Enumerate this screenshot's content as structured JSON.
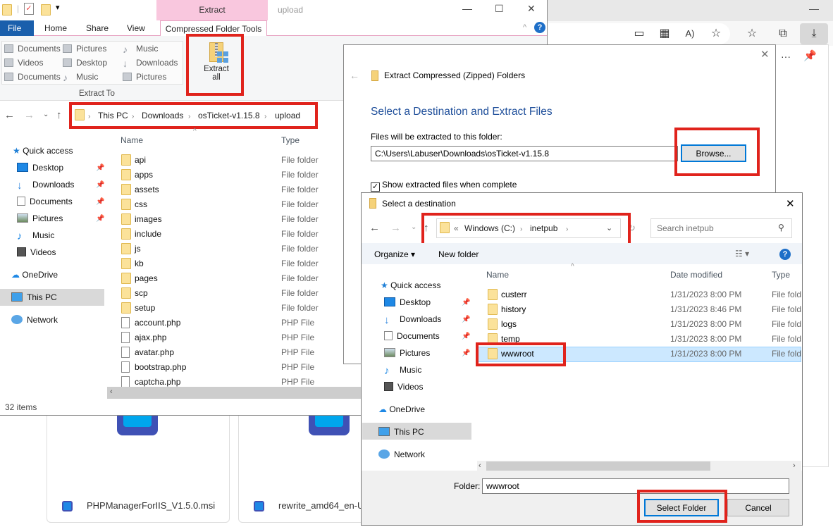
{
  "browser": {
    "toolbar_icons": [
      "app-available-icon",
      "tab-grid-icon",
      "read-aloud-icon",
      "add-favorite-icon",
      "favorites-icon",
      "collections-icon",
      "downloads-icon"
    ],
    "panel_icons": [
      "more-icon",
      "pin-icon"
    ],
    "downloads": [
      {
        "name": "PHPManagerForIIS_V1.5.0.msi"
      },
      {
        "name": "rewrite_amd64_en-U"
      }
    ]
  },
  "explorer": {
    "context_tab": "Extract",
    "window_title": "upload",
    "tabs": [
      "File",
      "Home",
      "Share",
      "View",
      "Compressed Folder Tools"
    ],
    "extract_to": {
      "items": [
        [
          "Documents",
          "Pictures",
          "Music"
        ],
        [
          "Videos",
          "Desktop",
          "Downloads"
        ],
        [
          "Documents",
          "Music",
          "Pictures"
        ]
      ],
      "group_label": "Extract To"
    },
    "extract_all_label_1": "Extract",
    "extract_all_label_2": "all",
    "breadcrumb": [
      "This PC",
      "Downloads",
      "osTicket-v1.15.8",
      "upload"
    ],
    "sidebar": {
      "quick_access": "Quick access",
      "items": [
        "Desktop",
        "Downloads",
        "Documents",
        "Pictures",
        "Music",
        "Videos"
      ],
      "onedrive": "OneDrive",
      "this_pc": "This PC",
      "network": "Network"
    },
    "columns": {
      "name": "Name",
      "type": "Type"
    },
    "files": [
      {
        "name": "api",
        "type": "File folder",
        "kind": "folder"
      },
      {
        "name": "apps",
        "type": "File folder",
        "kind": "folder"
      },
      {
        "name": "assets",
        "type": "File folder",
        "kind": "folder"
      },
      {
        "name": "css",
        "type": "File folder",
        "kind": "folder"
      },
      {
        "name": "images",
        "type": "File folder",
        "kind": "folder"
      },
      {
        "name": "include",
        "type": "File folder",
        "kind": "folder"
      },
      {
        "name": "js",
        "type": "File folder",
        "kind": "folder"
      },
      {
        "name": "kb",
        "type": "File folder",
        "kind": "folder"
      },
      {
        "name": "pages",
        "type": "File folder",
        "kind": "folder"
      },
      {
        "name": "scp",
        "type": "File folder",
        "kind": "folder"
      },
      {
        "name": "setup",
        "type": "File folder",
        "kind": "folder"
      },
      {
        "name": "account.php",
        "type": "PHP File",
        "kind": "file"
      },
      {
        "name": "ajax.php",
        "type": "PHP File",
        "kind": "file"
      },
      {
        "name": "avatar.php",
        "type": "PHP File",
        "kind": "file"
      },
      {
        "name": "bootstrap.php",
        "type": "PHP File",
        "kind": "file"
      },
      {
        "name": "captcha.php",
        "type": "PHP File",
        "kind": "file"
      }
    ],
    "status": "32 items"
  },
  "extract_dialog": {
    "title": "Extract Compressed (Zipped) Folders",
    "heading": "Select a Destination and Extract Files",
    "label": "Files will be extracted to this folder:",
    "path": "C:\\Users\\Labuser\\Downloads\\osTicket-v1.15.8",
    "browse": "Browse...",
    "show_files": "Show extracted files when complete",
    "show_files_checked": true
  },
  "select_dialog": {
    "title": "Select a destination",
    "breadcrumb_prefix": "«",
    "breadcrumb": [
      "Windows (C:)",
      "inetpub"
    ],
    "search_placeholder": "Search inetpub",
    "organize": "Organize ▾",
    "new_folder": "New folder",
    "sidebar": {
      "quick_access": "Quick access",
      "items": [
        "Desktop",
        "Downloads",
        "Documents",
        "Pictures",
        "Music",
        "Videos"
      ],
      "onedrive": "OneDrive",
      "this_pc": "This PC",
      "network": "Network"
    },
    "columns": {
      "name": "Name",
      "date": "Date modified",
      "type": "Type"
    },
    "rows": [
      {
        "name": "custerr",
        "date": "1/31/2023 8:00 PM",
        "type": "File folder"
      },
      {
        "name": "history",
        "date": "1/31/2023 8:46 PM",
        "type": "File folder"
      },
      {
        "name": "logs",
        "date": "1/31/2023 8:00 PM",
        "type": "File folder"
      },
      {
        "name": "temp",
        "date": "1/31/2023 8:00 PM",
        "type": "File folder"
      },
      {
        "name": "wwwroot",
        "date": "1/31/2023 8:00 PM",
        "type": "File folder",
        "selected": true
      }
    ],
    "folder_label": "Folder:",
    "folder_value": "wwwroot",
    "select_button": "Select Folder",
    "cancel_button": "Cancel"
  }
}
